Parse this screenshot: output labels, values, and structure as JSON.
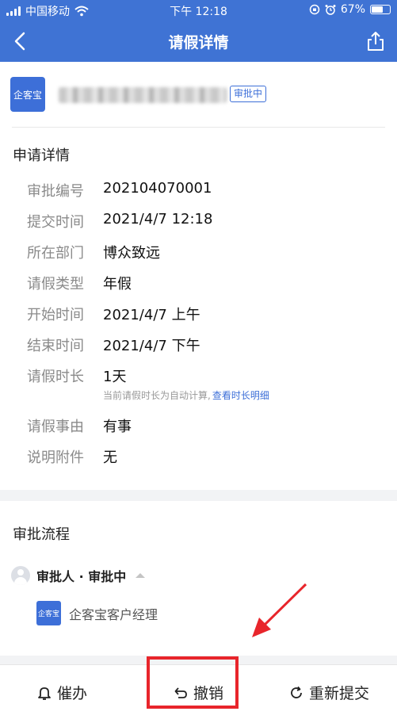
{
  "status_bar": {
    "carrier": "中国移动",
    "time": "下午 12:18",
    "battery_percent": "67%",
    "battery_level": 0.67
  },
  "nav": {
    "title": "请假详情",
    "back_icon": "chevron-left-icon",
    "share_icon": "share-icon"
  },
  "header": {
    "company_logo_text": "企客宝",
    "status_tag": "审批中"
  },
  "details": {
    "section_title": "申请详情",
    "rows": [
      {
        "label": "审批编号",
        "value": "202104070001"
      },
      {
        "label": "提交时间",
        "value": "2021/4/7 12:18"
      },
      {
        "label": "所在部门",
        "value": "博众致远"
      },
      {
        "label": "请假类型",
        "value": "年假"
      },
      {
        "label": "开始时间",
        "value": "2021/4/7 上午"
      },
      {
        "label": "结束时间",
        "value": "2021/4/7 下午"
      },
      {
        "label": "请假时长",
        "value": "1天"
      },
      {
        "label": "请假事由",
        "value": "有事"
      },
      {
        "label": "说明附件",
        "value": "无"
      }
    ],
    "duration_note": "当前请假时长为自动计算,",
    "duration_link": "查看时长明细"
  },
  "flow": {
    "section_title": "审批流程",
    "step_title": "审批人 · 审批中",
    "approver_logo_text": "企客宝",
    "approver_name": "企客宝客户经理"
  },
  "bottom_bar": {
    "urge_label": "催办",
    "revoke_label": "撤销",
    "resubmit_label": "重新提交"
  },
  "colors": {
    "primary": "#3f73d4",
    "annotation": "#e8252b"
  }
}
